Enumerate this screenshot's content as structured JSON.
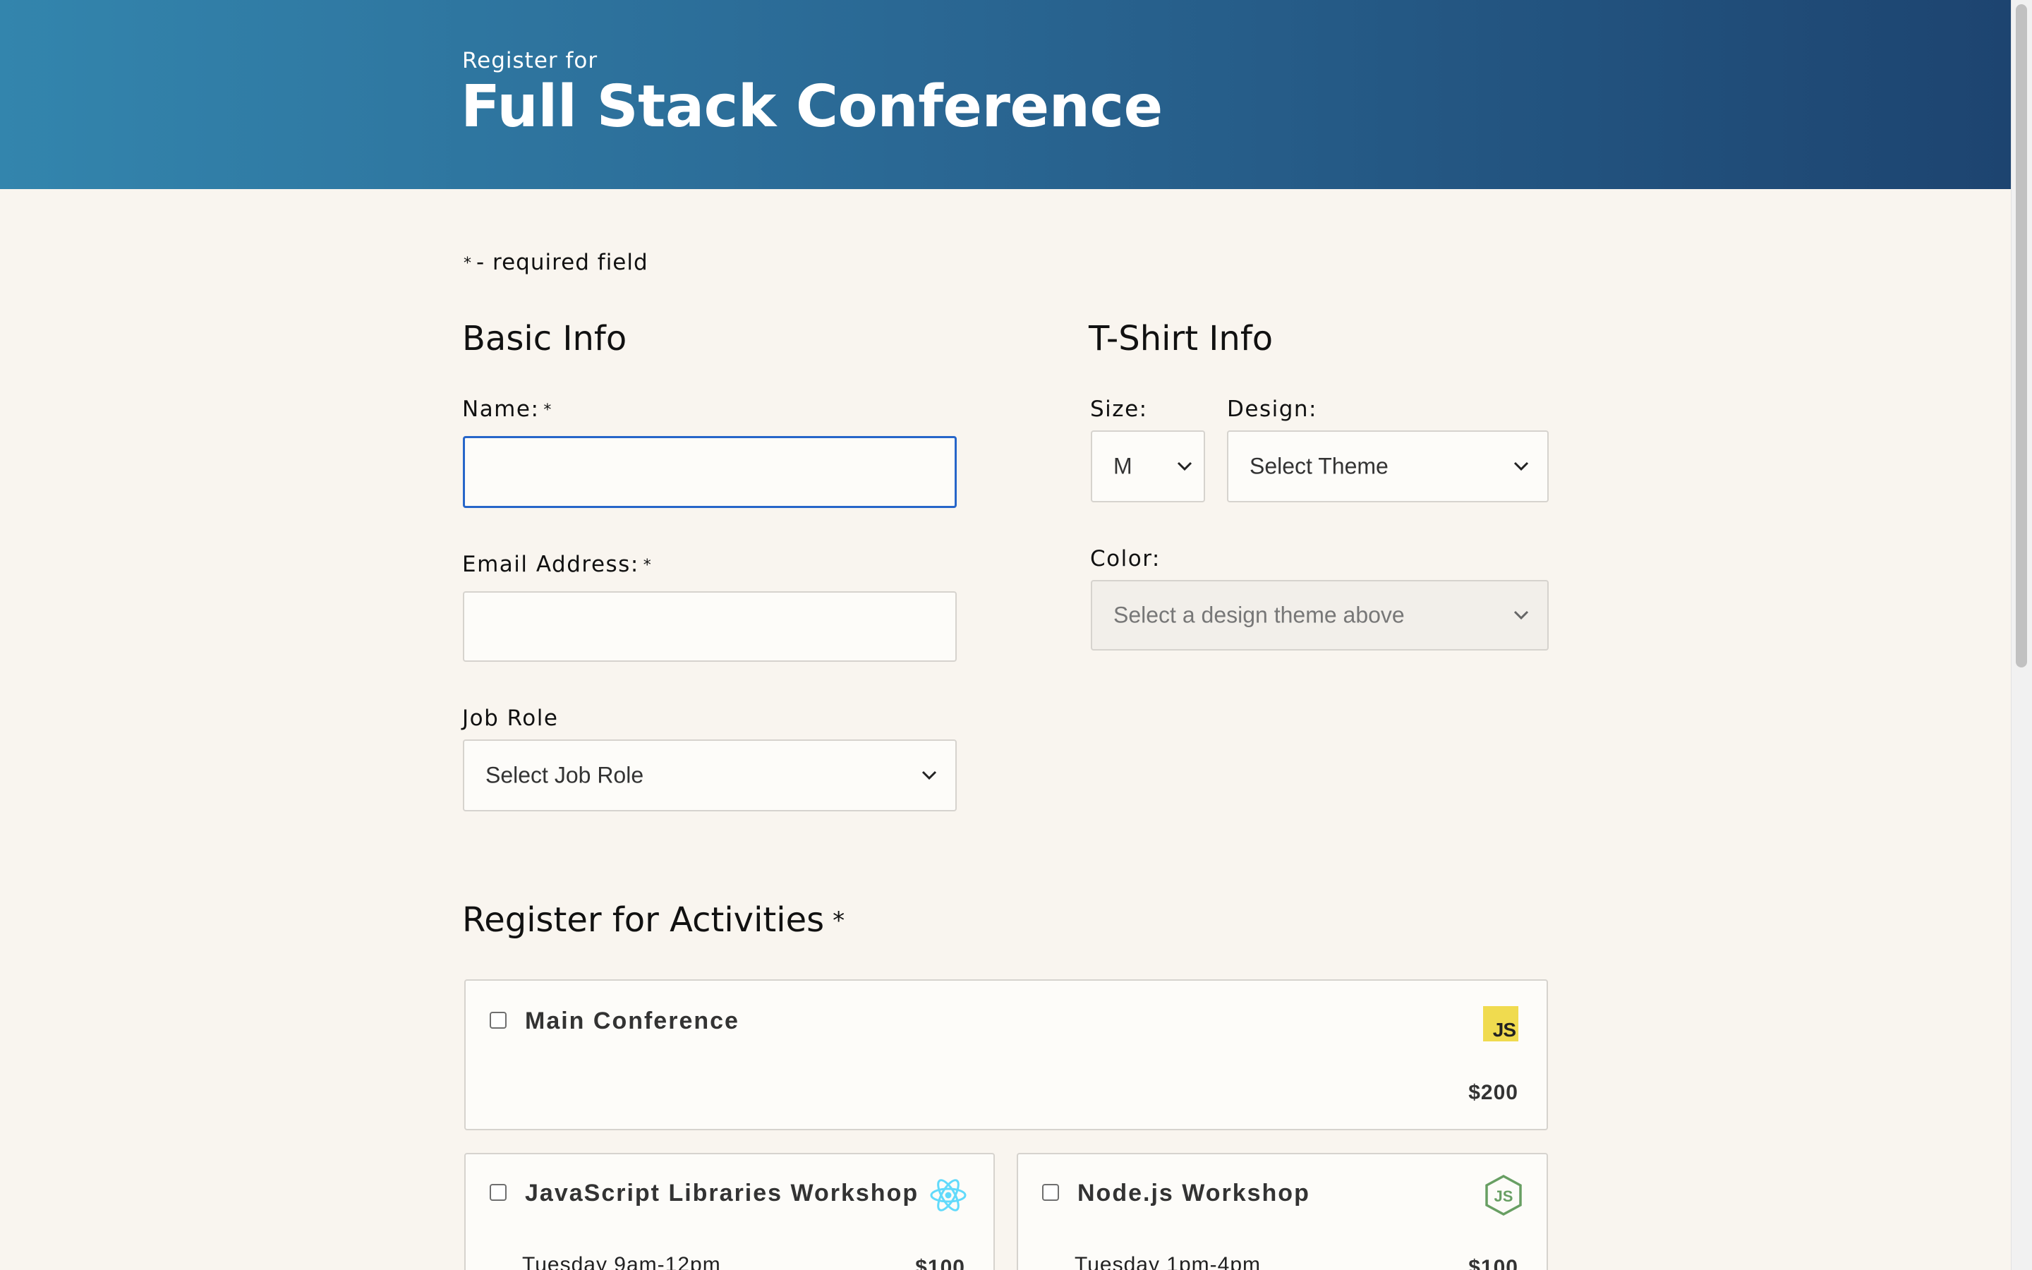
{
  "header": {
    "kicker": "Register for",
    "title": "Full Stack Conference"
  },
  "required_note": {
    "star": "*",
    "text": "- required field"
  },
  "basic_info": {
    "title": "Basic Info",
    "name_label": "Name:",
    "name_value": "",
    "email_label": "Email Address:",
    "email_value": "",
    "job_role_label": "Job Role",
    "job_role_selected": "Select Job Role",
    "required_star": "*"
  },
  "tshirt_info": {
    "title": "T-Shirt Info",
    "size_label": "Size:",
    "size_selected": "M",
    "design_label": "Design:",
    "design_selected": "Select Theme",
    "color_label": "Color:",
    "color_selected": "Select a design theme above"
  },
  "activities": {
    "title": "Register for Activities",
    "required_star": "*",
    "items": [
      {
        "name": "Main Conference",
        "time": "",
        "price": "$200",
        "checked": false,
        "icon": "js-icon",
        "icon_text": "JS"
      },
      {
        "name": "JavaScript Libraries Workshop",
        "time": "Tuesday 9am-12pm",
        "price": "$100",
        "checked": false,
        "icon": "react-icon"
      },
      {
        "name": "Node.js Workshop",
        "time": "Tuesday 1pm-4pm",
        "price": "$100",
        "checked": false,
        "icon": "nodejs-icon"
      }
    ]
  },
  "colors": {
    "header_gradient_start": "#3385ad",
    "header_gradient_end": "#1d4470",
    "page_background": "#f9f5ef",
    "focus_border": "#2766c9",
    "js_yellow": "#f0db4f",
    "react_cyan": "#61dafb",
    "node_green": "#689f63"
  }
}
